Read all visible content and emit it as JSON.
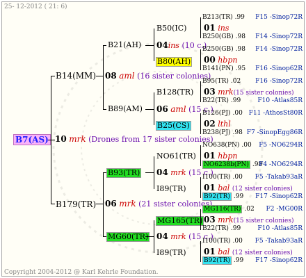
{
  "header": {
    "date": "25- 12-2012 ( 21: 6)"
  },
  "footer": {
    "copyright": "Copyright 2004-2012 @ Karl Kehrle Foundation."
  },
  "root": {
    "label": "B7(AS)",
    "gen": "10",
    "race": "mrk",
    "note": "(Drones from 17 sister colonies)"
  },
  "gen1": [
    {
      "label": "B14(MM)",
      "gen": "08",
      "race": "aml",
      "note": "(16 sister colonies)"
    },
    {
      "label": "B179(TR)",
      "gen": "06",
      "race": "mrk",
      "note": "(21 sister colonies)"
    }
  ],
  "gen2": [
    {
      "label": "B21(AH)",
      "gen": "04",
      "race": "ins",
      "note": "(10 c.)"
    },
    {
      "label": "B89(AM)",
      "gen": "06",
      "race": "aml",
      "note": "(15 c.)"
    },
    {
      "label": "B93(TR)",
      "gen": "04",
      "race": "mrk",
      "note": "(15 c.)"
    },
    {
      "label": "MG60(TR)",
      "gen": "04",
      "race": "mrk",
      "note": "(15 c.)"
    }
  ],
  "gen3": [
    {
      "label": "B50(IC)"
    },
    {
      "label": "B80(AH)"
    },
    {
      "label": "B128(TR)"
    },
    {
      "label": "B25(CS)"
    },
    {
      "label": "NO61(TR)"
    },
    {
      "label": "I89(TR)"
    },
    {
      "label": "MG165(TR)"
    },
    {
      "label": "I89(TR)"
    }
  ],
  "gen3_mid": [
    {
      "gen": "01",
      "race": "ins",
      "note": ""
    },
    {
      "gen": "00",
      "race": "hbpn",
      "note": ""
    },
    {
      "gen": "03",
      "race": "mrk",
      "note": "(15 sister colonies)"
    },
    {
      "gen": "02",
      "race": "lthl",
      "note": ""
    },
    {
      "gen": "01",
      "race": "hbpn",
      "note": ""
    },
    {
      "gen": "01",
      "race": "bal",
      "note": "(12 sister colonies)"
    },
    {
      "gen": "03",
      "race": "mrk",
      "note": "(15 sister colonies)"
    },
    {
      "gen": "01",
      "race": "bal",
      "note": "(12 sister colonies)"
    }
  ],
  "gen4": [
    {
      "label": "B213(TR)",
      "pct": ".99",
      "ref": "F15 -Sinop72R"
    },
    {
      "label": "B250(GB)",
      "pct": ".98",
      "ref": "F14 -Sinop72R"
    },
    {
      "label": "B250(GB)",
      "pct": ".98",
      "ref": "F14 -Sinop72R"
    },
    {
      "label": "B141(PN)",
      "pct": ".95",
      "ref": "F16 -Sinop62R"
    },
    {
      "label": "B95(TR)",
      "pct": ".02",
      "ref": "F16 -Sinop72R"
    },
    {
      "label": "B22(TR)",
      "pct": ".99",
      "ref": "F10 -Atlas85R"
    },
    {
      "label": "B126(PJ)",
      "pct": ".00",
      "ref": "F11 -AthosSt80R"
    },
    {
      "label": "B238(PJ)",
      "pct": ".98",
      "ref": "F7 -SinopEgg86R"
    },
    {
      "label": "NO638(PN)",
      "pct": ".00",
      "ref": "F5 -NO6294R"
    },
    {
      "label": "NO6238b(PN)",
      "pct": ".98",
      "ref": "F4 -NO6294R"
    },
    {
      "label": "I100(TR)",
      "pct": ".00",
      "ref": "F5 -Takab93aR"
    },
    {
      "label": "B92(TR)",
      "pct": ".99",
      "ref": "F17 -Sinop62R"
    },
    {
      "label": "MG116(TR)",
      "pct": ".02",
      "ref": "F2 -MG00R"
    },
    {
      "label": "B22(TR)",
      "pct": ".99",
      "ref": "F10 -Atlas85R"
    },
    {
      "label": "I100(TR)",
      "pct": ".00",
      "ref": "F5 -Takab93aR"
    },
    {
      "label": "B92(TR)",
      "pct": ".99",
      "ref": "F17 -Sinop62R"
    }
  ],
  "colors": {
    "yellow": "#ffff00",
    "green": "#22dd22",
    "cyan": "#33e3f0",
    "pink": "#f9b2f9",
    "red": "#cc0000",
    "blue": "#001f9f"
  }
}
